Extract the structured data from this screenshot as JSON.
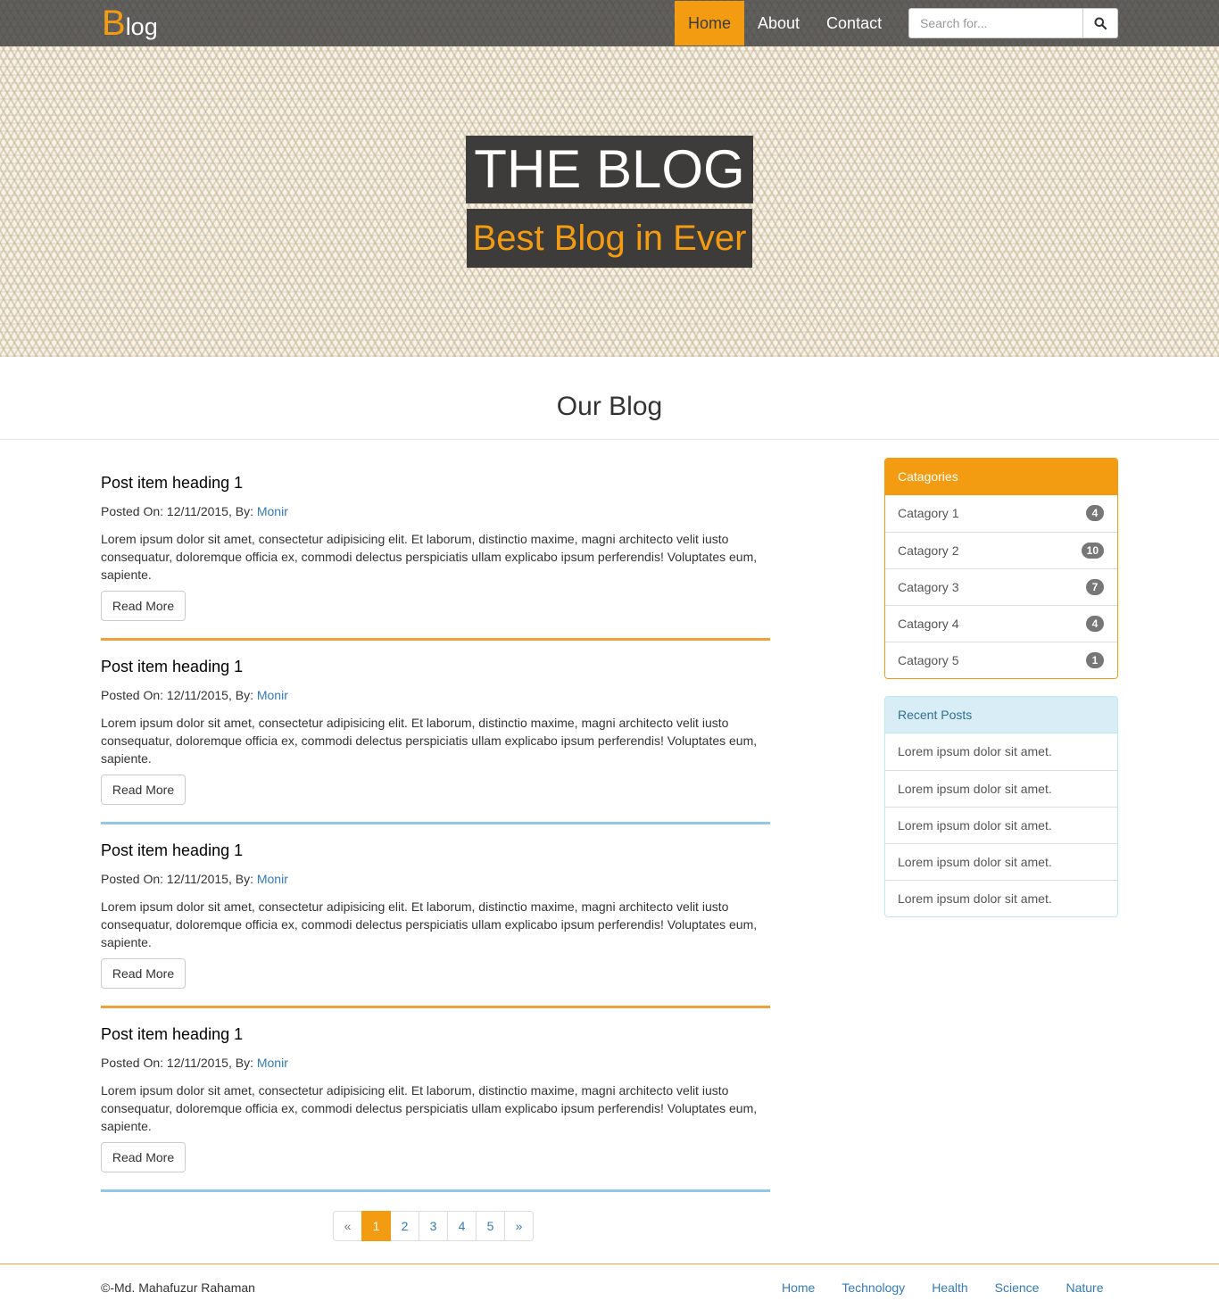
{
  "brand": {
    "first_letter": "B",
    "rest": "log"
  },
  "nav": {
    "items": [
      "Home",
      "About",
      "Contact"
    ],
    "active": "Home"
  },
  "search": {
    "placeholder": "Search for..."
  },
  "hero": {
    "title": "THE BLOG",
    "subtitle": "Best Blog in Ever"
  },
  "section": {
    "title": "Our Blog"
  },
  "posts": [
    {
      "heading": "Post item heading 1",
      "meta_prefix": "Posted On: 12/11/2015, By: ",
      "author": "Monir",
      "body": "Lorem ipsum dolor sit amet, consectetur adipisicing elit. Et laborum, distinctio maxime, magni architecto velit iusto consequatur, doloremque officia ex, commodi delectus perspiciatis ullam explicabo ipsum perferendis! Voluptates eum, sapiente.",
      "button": "Read More",
      "rule_color": "#f0a23a"
    },
    {
      "heading": "Post item heading 1",
      "meta_prefix": "Posted On: 12/11/2015, By: ",
      "author": "Monir",
      "body": "Lorem ipsum dolor sit amet, consectetur adipisicing elit. Et laborum, distinctio maxime, magni architecto velit iusto consequatur, doloremque officia ex, commodi delectus perspiciatis ullam explicabo ipsum perferendis! Voluptates eum, sapiente.",
      "button": "Read More",
      "rule_color": "#90c8e8"
    },
    {
      "heading": "Post item heading 1",
      "meta_prefix": "Posted On: 12/11/2015, By: ",
      "author": "Monir",
      "body": "Lorem ipsum dolor sit amet, consectetur adipisicing elit. Et laborum, distinctio maxime, magni architecto velit iusto consequatur, doloremque officia ex, commodi delectus perspiciatis ullam explicabo ipsum perferendis! Voluptates eum, sapiente.",
      "button": "Read More",
      "rule_color": "#f0a23a"
    },
    {
      "heading": "Post item heading 1",
      "meta_prefix": "Posted On: 12/11/2015, By: ",
      "author": "Monir",
      "body": "Lorem ipsum dolor sit amet, consectetur adipisicing elit. Et laborum, distinctio maxime, magni architecto velit iusto consequatur, doloremque officia ex, commodi delectus perspiciatis ullam explicabo ipsum perferendis! Voluptates eum, sapiente.",
      "button": "Read More",
      "rule_color": "#90c8e8"
    }
  ],
  "pagination": {
    "prev": "«",
    "pages": [
      "1",
      "2",
      "3",
      "4",
      "5"
    ],
    "next": "»",
    "active": "1"
  },
  "categories": {
    "title": "Catagories",
    "items": [
      {
        "label": "Catagory 1",
        "count": "4"
      },
      {
        "label": "Catagory 2",
        "count": "10"
      },
      {
        "label": "Catagory 3",
        "count": "7"
      },
      {
        "label": "Catagory 4",
        "count": "4"
      },
      {
        "label": "Catagory 5",
        "count": "1"
      }
    ]
  },
  "recent_posts": {
    "title": "Recent Posts",
    "items": [
      "Lorem ipsum dolor sit amet.",
      "Lorem ipsum dolor sit amet.",
      "Lorem ipsum dolor sit amet.",
      "Lorem ipsum dolor sit amet.",
      "Lorem ipsum dolor sit amet."
    ]
  },
  "footer": {
    "copyright": "©-Md. Mahafuzur Rahaman",
    "links": [
      "Home",
      "Technology",
      "Health",
      "Science",
      "Nature"
    ]
  },
  "colors": {
    "accent": "#f39c12",
    "link": "#337ab7",
    "info_bg": "#d9edf7",
    "rule_blue": "#90c8e8"
  },
  "icons": {
    "search": "search-icon"
  }
}
